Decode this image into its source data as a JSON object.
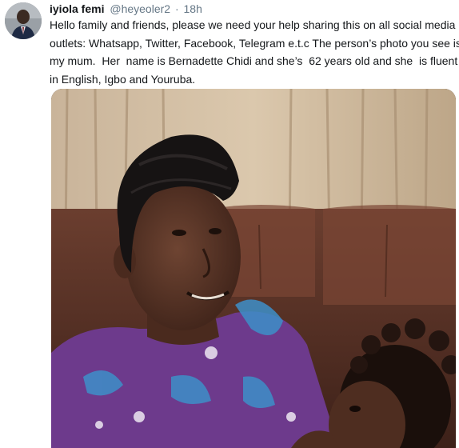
{
  "tweet": {
    "author_name": "iyiola femi",
    "handle": "@heyeoler2",
    "separator": "·",
    "time": "18h",
    "text_lines": [
      "Hello family and friends, please we need your help sharing this on all social media",
      "outlets: Whatsapp, Twitter, Facebook, Telegram e.t.c The person’s photo you see is",
      "my mum.  Her  name is Bernadette Chidi and she’s  62 years old and she  is fluent",
      "in English, Igbo and Youruba."
    ]
  },
  "colors": {
    "text": "#14171a",
    "secondary": "#657786"
  }
}
